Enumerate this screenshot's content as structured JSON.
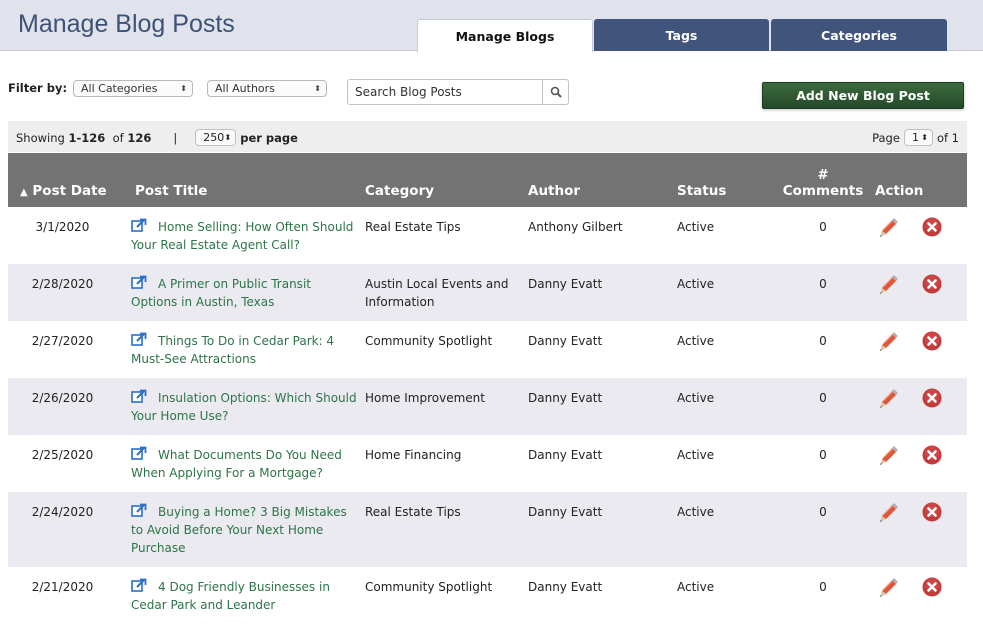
{
  "header": {
    "title": "Manage Blog Posts",
    "tabs": [
      {
        "label": "Manage Blogs",
        "active": true
      },
      {
        "label": "Tags",
        "active": false
      },
      {
        "label": "Categories",
        "active": false
      }
    ]
  },
  "filters": {
    "label": "Filter by:",
    "category_select": "All Categories",
    "author_select": "All Authors",
    "search_placeholder": "Search Blog Posts",
    "search_icon": "search-icon"
  },
  "add_button_label": "Add New Blog Post",
  "pager": {
    "showing_label": "Showing",
    "range": "1-126",
    "of_label": "of",
    "total": "126",
    "separator": "|",
    "per_page_value": "250",
    "per_page_label": "per page",
    "page_label": "Page",
    "page_value": "1",
    "page_of_label": "of 1"
  },
  "colors": {
    "header_bg": "#e0e3ec",
    "title_color": "#3d5277",
    "tab_inactive": "#41557c",
    "table_header": "#737373",
    "link_green": "#2d7448",
    "add_button": "#2f5a33",
    "row_alt": "#ebeaf0"
  },
  "table": {
    "sort_indicator": "▲",
    "columns": {
      "date": "Post Date",
      "title": "Post Title",
      "category": "Category",
      "author": "Author",
      "status": "Status",
      "comments_line1": "#",
      "comments_line2": "Comments",
      "action": "Action"
    },
    "rows": [
      {
        "date": "3/1/2020",
        "title": "Home Selling: How Often Should Your Real Estate Agent Call?",
        "category": "Real Estate Tips",
        "author": "Anthony Gilbert",
        "status": "Active",
        "comments": "0"
      },
      {
        "date": "2/28/2020",
        "title": "A Primer on Public Transit Options in Austin, Texas",
        "category": "Austin Local Events and Information",
        "author": "Danny Evatt",
        "status": "Active",
        "comments": "0"
      },
      {
        "date": "2/27/2020",
        "title": "Things To Do in Cedar Park: 4 Must-See Attractions",
        "category": "Community Spotlight",
        "author": "Danny Evatt",
        "status": "Active",
        "comments": "0"
      },
      {
        "date": "2/26/2020",
        "title": "Insulation Options: Which Should Your Home Use?",
        "category": "Home Improvement",
        "author": "Danny Evatt",
        "status": "Active",
        "comments": "0"
      },
      {
        "date": "2/25/2020",
        "title": "What Documents Do You Need When Applying For a Mortgage?",
        "category": "Home Financing",
        "author": "Danny Evatt",
        "status": "Active",
        "comments": "0"
      },
      {
        "date": "2/24/2020",
        "title": "Buying a Home? 3 Big Mistakes to Avoid Before Your Next Home Purchase",
        "category": "Real Estate Tips",
        "author": "Danny Evatt",
        "status": "Active",
        "comments": "0"
      },
      {
        "date": "2/21/2020",
        "title": "4 Dog Friendly Businesses in Cedar Park and Leander",
        "category": "Community Spotlight",
        "author": "Danny Evatt",
        "status": "Active",
        "comments": "0"
      }
    ]
  }
}
